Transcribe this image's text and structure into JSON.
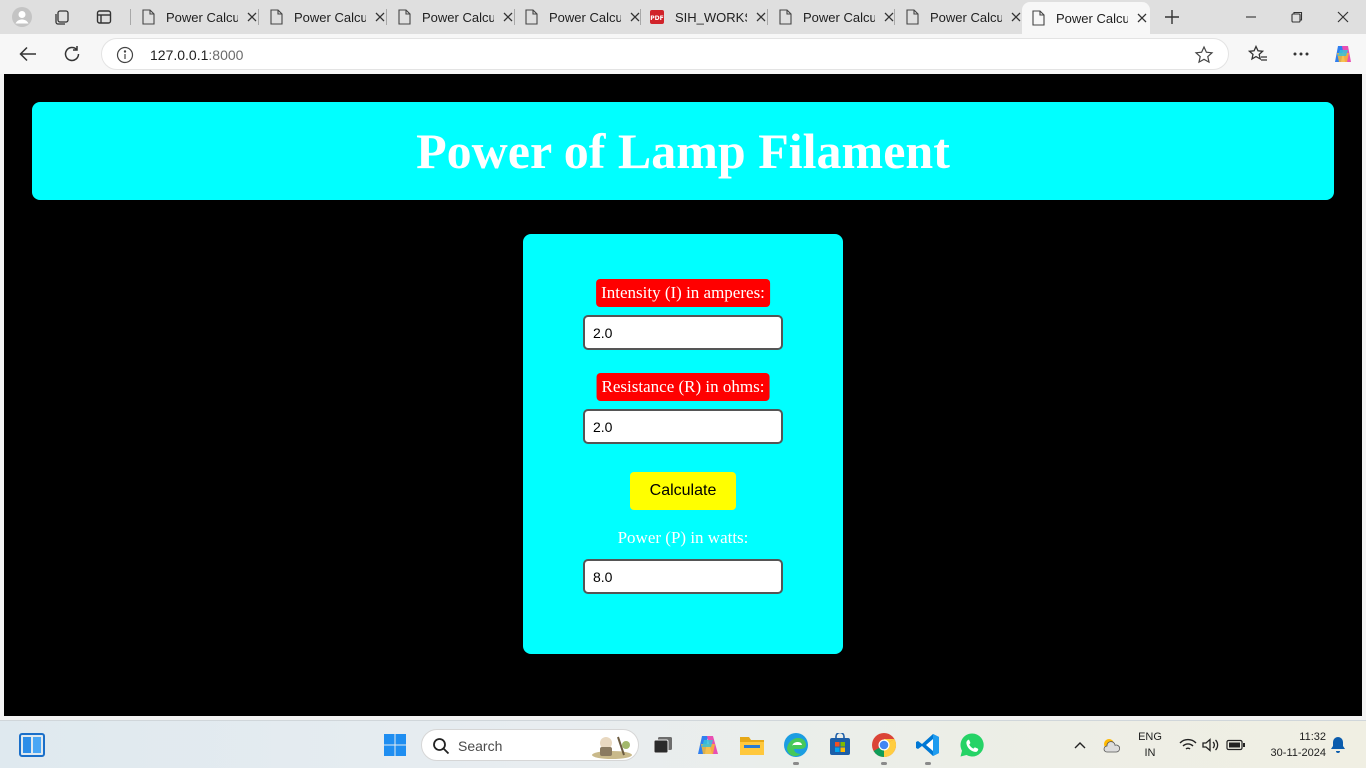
{
  "browser": {
    "tabs": [
      {
        "title": "Power Calcul",
        "icon": "page-icon"
      },
      {
        "title": "Power Calcul",
        "icon": "page-icon"
      },
      {
        "title": "Power Calcul",
        "icon": "page-icon"
      },
      {
        "title": "Power Calcul",
        "icon": "page-icon"
      },
      {
        "title": "SIH_WORKSH",
        "icon": "pdf-icon"
      },
      {
        "title": "Power Calcul",
        "icon": "page-icon"
      },
      {
        "title": "Power Calcul",
        "icon": "page-icon"
      },
      {
        "title": "Power Calcul",
        "icon": "page-icon",
        "active": true
      }
    ],
    "url_host": "127.0.0.1",
    "url_port": ":8000"
  },
  "page": {
    "heading": "Power of Lamp Filament",
    "intensity_label": "Intensity (I) in amperes:",
    "intensity_value": "2.0",
    "resistance_label": "Resistance (R) in ohms:",
    "resistance_value": "2.0",
    "calculate_label": "Calculate",
    "power_label": "Power (P) in watts:",
    "power_value": "8.0"
  },
  "taskbar": {
    "search_placeholder": "Search",
    "language": "ENG",
    "region": "IN",
    "time": "11:32",
    "date": "30-11-2024"
  },
  "colors": {
    "header_bg": "#00ffff",
    "page_bg": "#000000",
    "label_bg": "#ff0000",
    "button_bg": "#ffff00"
  }
}
